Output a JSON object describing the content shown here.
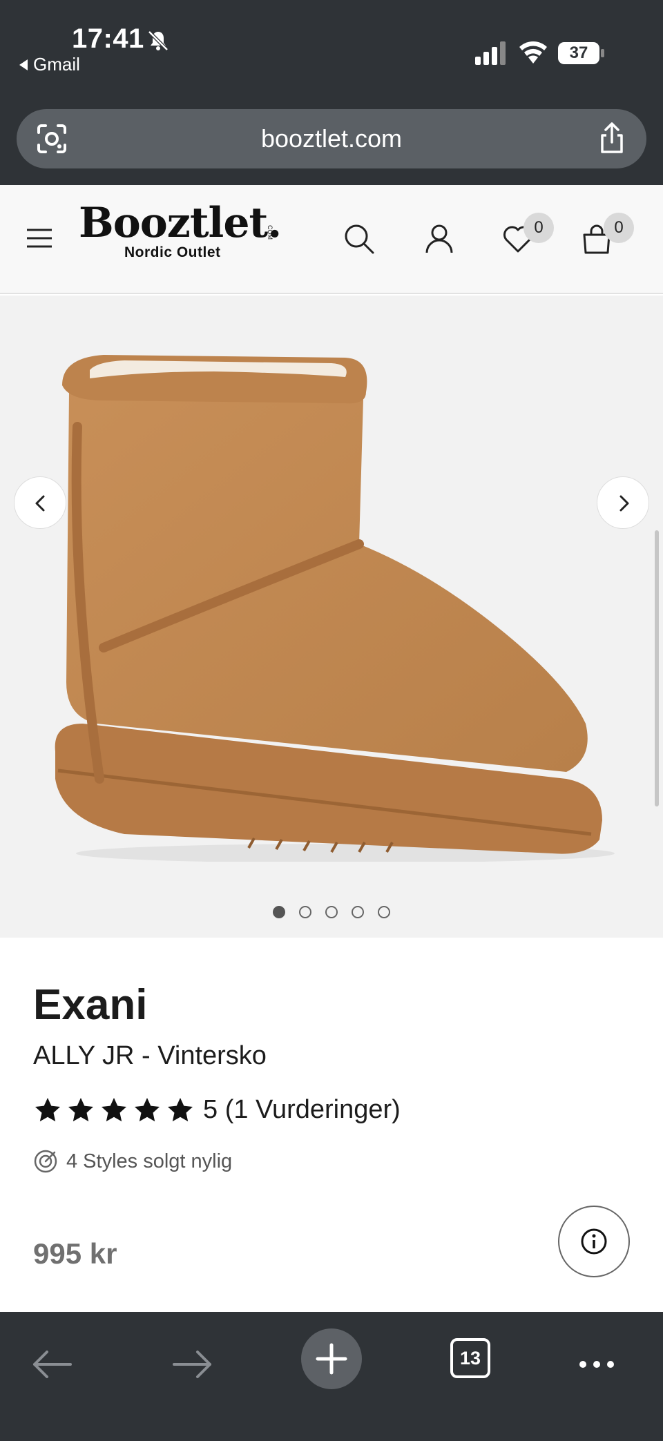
{
  "status_bar": {
    "time": "17:41",
    "back_app": "Gmail",
    "battery": "37"
  },
  "browser": {
    "url": "booztlet.com",
    "tabs_count": "13"
  },
  "site": {
    "logo_text": "Booztlet.",
    "logo_com": "COM",
    "logo_subtitle": "Nordic Outlet",
    "wishlist_count": "0",
    "cart_count": "0"
  },
  "gallery": {
    "image_count": 5,
    "active_index": 0
  },
  "product": {
    "brand": "Exani",
    "name": "ALLY JR - Vintersko",
    "rating_value": 5,
    "rating_text": "5 (1 Vurderinger)",
    "sold_text": "4 Styles solgt nylig",
    "price": "995 kr"
  },
  "colors": {
    "chrome_bg": "#2f3337",
    "url_bar_bg": "#5b6065",
    "gallery_bg": "#f2f2f2",
    "boot": "#c58a52",
    "price_text": "#707070"
  }
}
